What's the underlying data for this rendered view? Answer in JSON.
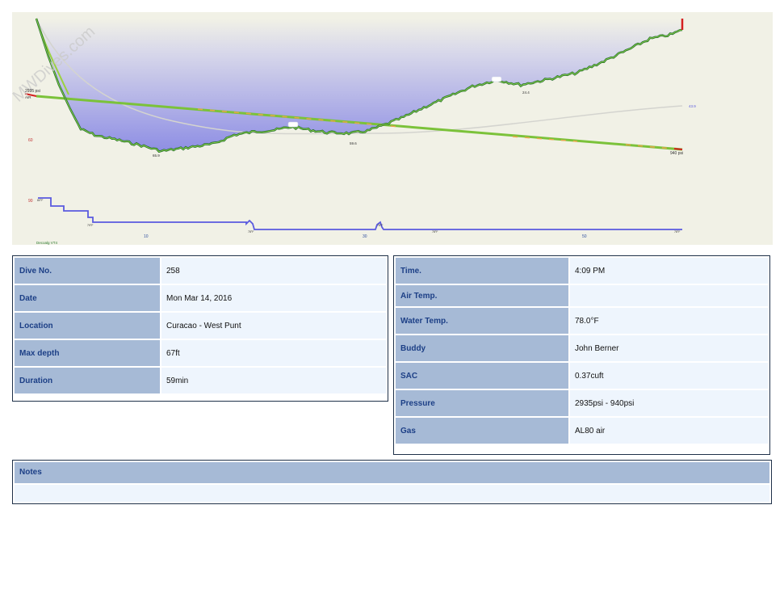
{
  "profile": {
    "watermark": "MWDives.com",
    "start_pressure_label": "2935 psi",
    "air_label": "AIR",
    "end_pressure_label": "940 psi",
    "depth_scale_labels": [
      "60",
      "90"
    ],
    "time_labels": [
      "10",
      "30",
      "50"
    ],
    "depth_point_labels": [
      "65.9",
      "59.6",
      "24.4"
    ],
    "temp_right_label": "43.9",
    "deco_label": "Decoalg VT4",
    "temp_labels": [
      "80°F",
      "79°F",
      "78°F",
      "78°F",
      "78°F",
      "78°F"
    ]
  },
  "dive": {
    "dive_no": {
      "label": "Dive No.",
      "value": "258"
    },
    "date": {
      "label": "Date",
      "value": "Mon Mar 14, 2016"
    },
    "location": {
      "label": "Location",
      "value": "Curacao - West Punt"
    },
    "max_depth": {
      "label": "Max depth",
      "value": "67ft"
    },
    "duration": {
      "label": "Duration",
      "value": "59min"
    },
    "time": {
      "label": "Time.",
      "value": "4:09 PM"
    },
    "air_temp": {
      "label": "Air Temp.",
      "value": ""
    },
    "water_temp": {
      "label": "Water Temp.",
      "value": "78.0°F"
    },
    "buddy": {
      "label": "Buddy",
      "value": "John Berner"
    },
    "sac": {
      "label": "SAC",
      "value": "0.37cuft"
    },
    "pressure": {
      "label": "Pressure",
      "value": "2935psi - 940psi"
    },
    "gas": {
      "label": "Gas",
      "value": "AL80 air"
    }
  },
  "notes": {
    "label": "Notes",
    "value": ""
  },
  "colors": {
    "plot_bg": "#f1f1e6",
    "depth_fill": "#9a9ae6",
    "depth_line": "#1f6a2a",
    "pressure_line": "#7bc23a",
    "temp_line": "#5a5adf",
    "header_cell": "#a6bad6",
    "value_cell": "#eef5fd",
    "label_text": "#1c3f86"
  }
}
